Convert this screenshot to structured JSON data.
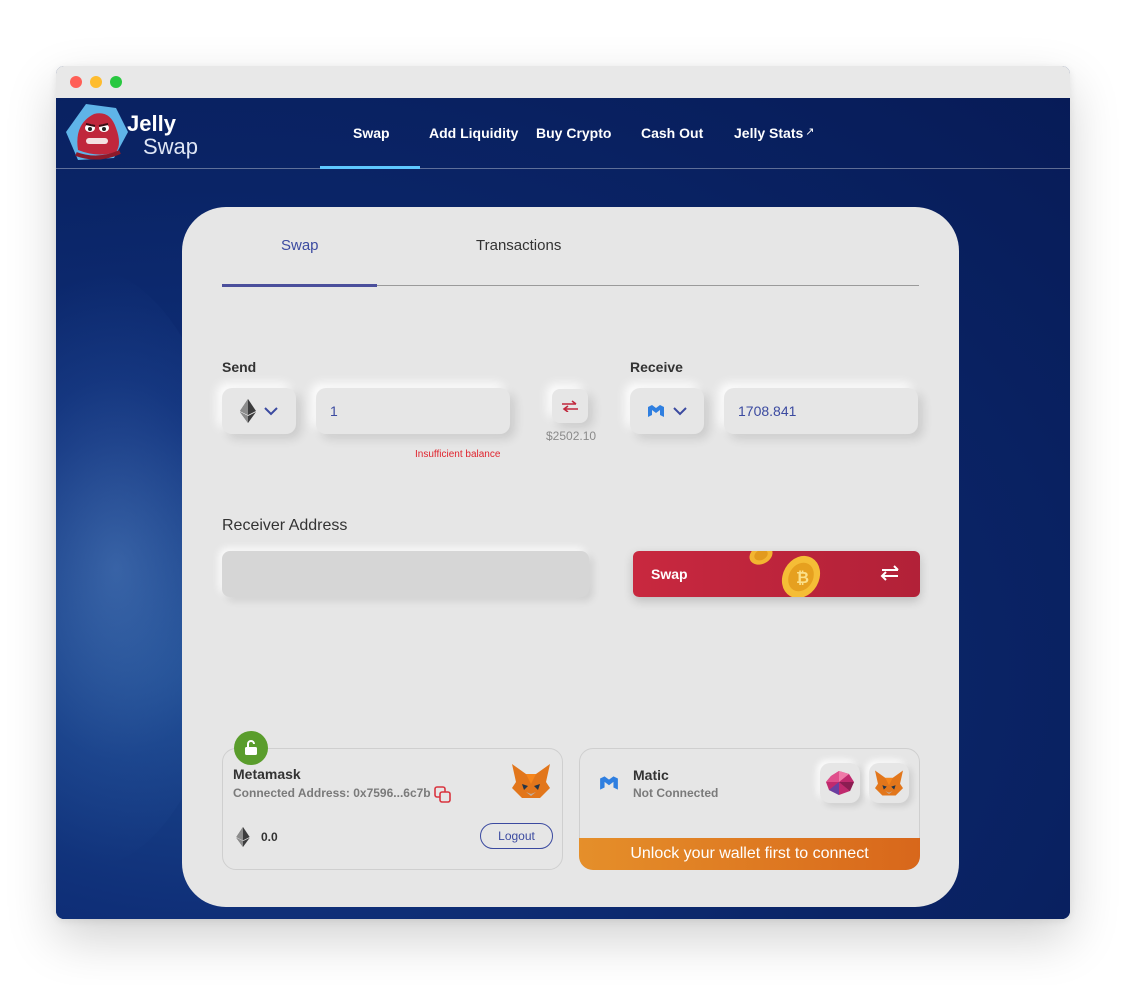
{
  "brand": {
    "line1": "Jelly",
    "line2": "Swap"
  },
  "nav": {
    "items": [
      {
        "label": "Swap"
      },
      {
        "label": "Add Liquidity"
      },
      {
        "label": "Buy Crypto"
      },
      {
        "label": "Cash Out"
      },
      {
        "label": "Jelly Stats"
      }
    ],
    "external_mark": "↗",
    "active": "Swap"
  },
  "tabs": {
    "swap": "Swap",
    "transactions": "Transactions",
    "active": "Swap"
  },
  "send": {
    "label": "Send",
    "asset_icon": "ethereum-icon",
    "amount": "1",
    "error": "Insufficient balance"
  },
  "receive": {
    "label": "Receive",
    "asset_icon": "matic-icon",
    "amount": "1708.841"
  },
  "usd_value": "$2502.10",
  "receiver": {
    "label": "Receiver Address",
    "value": ""
  },
  "swap_button": {
    "label": "Swap"
  },
  "wallets": {
    "metamask": {
      "title": "Metamask",
      "address_line": "Connected Address: 0x7596...6c7b",
      "balance": "0.0",
      "logout_label": "Logout",
      "status_icon": "unlock-icon"
    },
    "matic": {
      "title": "Matic",
      "status": "Not Connected",
      "unlock_label": "Unlock your wallet first to connect"
    }
  },
  "colors": {
    "accent": "#3b4aa0",
    "swap_button": "#c8283f",
    "error": "#e0242e",
    "unlock_banner": "#e58f2a",
    "lock_badge": "#5a9d2c",
    "nav_active": "#5ec8ff"
  }
}
